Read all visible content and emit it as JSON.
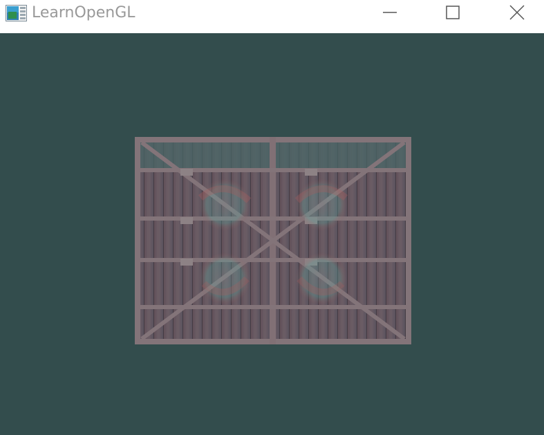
{
  "window": {
    "title": "LearnOpenGL",
    "clear_color": "#334d4d",
    "controls": {
      "minimize": "minimize-icon",
      "maximize": "maximize-icon",
      "close": "close-icon"
    }
  },
  "scene": {
    "content": "textured-quad",
    "texture_primary": "wooden-container",
    "texture_secondary": "smiley-face-overlay",
    "colors": {
      "wood_dark": "#5a4a55",
      "wood_mid": "#7a6670",
      "wood_light": "#8f7a80",
      "top_plank": "#4e6b6b"
    }
  }
}
